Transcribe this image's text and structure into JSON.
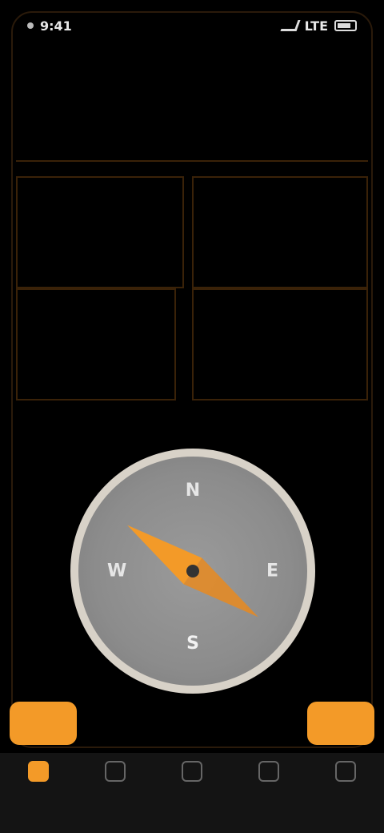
{
  "status_bar": {
    "time": "9:41",
    "network": "LTE",
    "carrier": ""
  },
  "subbar": {
    "left": "",
    "right": ""
  },
  "panels": [
    {
      "label": "",
      "value": ""
    },
    {
      "label": "",
      "value": ""
    },
    {
      "label": "",
      "value": ""
    },
    {
      "label": "",
      "value": ""
    }
  ],
  "heading": {
    "label": "",
    "value": ""
  },
  "compass": {
    "n": "N",
    "s": "S",
    "e": "E",
    "w": "W",
    "needle_deg": 35
  },
  "actions": {
    "left": "",
    "right": "",
    "middle": ""
  },
  "tabs": [
    {
      "label": "",
      "active": true
    },
    {
      "label": "",
      "active": false
    },
    {
      "label": "",
      "active": false
    },
    {
      "label": "",
      "active": false
    },
    {
      "label": "",
      "active": false
    }
  ],
  "colors": {
    "accent": "#f39a28",
    "border": "#3a2208",
    "background": "#000000"
  }
}
